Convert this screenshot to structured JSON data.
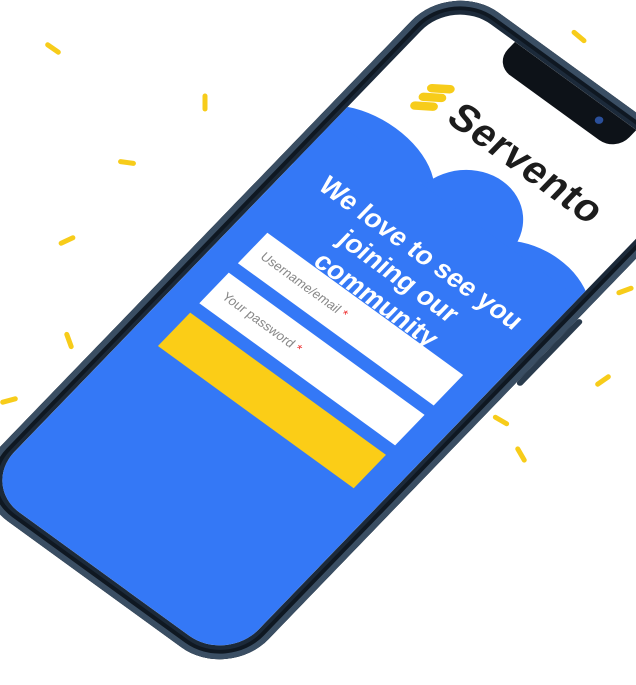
{
  "brand": {
    "name": "Servento",
    "accent": "#3478f6",
    "highlight": "#f7cc1a"
  },
  "form": {
    "heading_line1": "We love to see you",
    "heading_line2": "joining our community",
    "username_placeholder": "Username/email",
    "password_placeholder": "Your password",
    "required_mark": "*"
  }
}
